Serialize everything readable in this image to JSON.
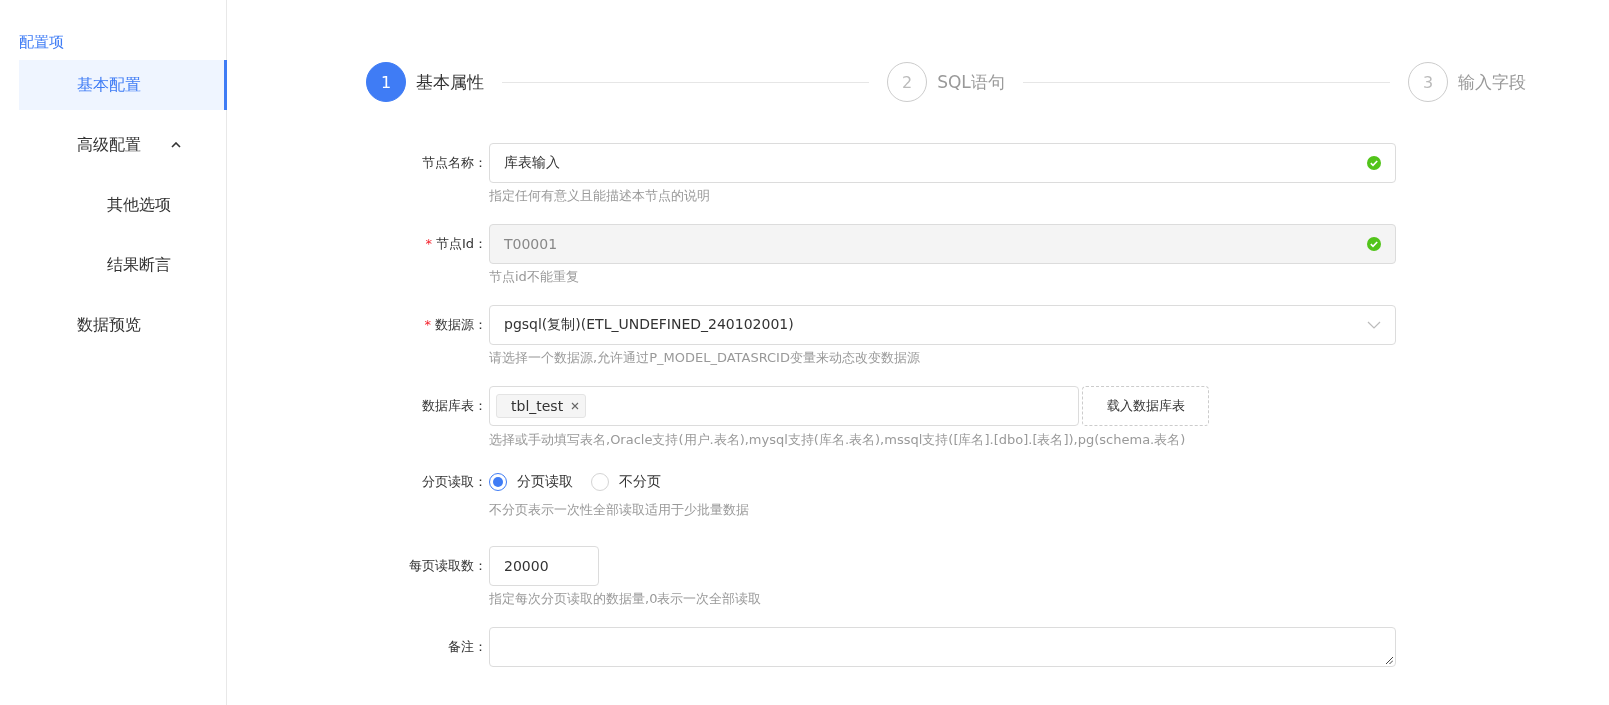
{
  "sidebar": {
    "title": "配置项",
    "items": [
      {
        "label": "基本配置",
        "selected": true
      },
      {
        "label": "高级配置",
        "selected": false,
        "expanded": true,
        "children": [
          {
            "label": "其他选项",
            "selected": false
          },
          {
            "label": "结果断言",
            "selected": false
          }
        ]
      },
      {
        "label": "数据预览",
        "selected": false
      }
    ]
  },
  "steps": [
    {
      "number": "1",
      "label": "基本属性",
      "selected": true
    },
    {
      "number": "2",
      "label": "SQL语句",
      "selected": false
    },
    {
      "number": "3",
      "label": "输入字段",
      "selected": false
    }
  ],
  "form": [
    {
      "kind": "text",
      "label": "节点名称：",
      "value": "库表输入",
      "disabled": false,
      "valid": true,
      "help": "指定任何有意义且能描述本节点的说明"
    },
    {
      "kind": "text",
      "label": "节点Id：",
      "mark": "*",
      "value": "T00001",
      "disabled": true,
      "valid": true,
      "help": "节点id不能重复"
    },
    {
      "kind": "select",
      "label": "数据源：",
      "mark": "*",
      "value": "pgsql(复制)(ETL_UNDEFINED_240102001)",
      "help": "请选择一个数据源,允许通过P_MODEL_DATASRCID变量来动态改变数据源"
    },
    {
      "kind": "tags",
      "label": "数据库表：",
      "tags": [
        "tbl_test"
      ],
      "button": "载入数据库表",
      "help": "选择或手动填写表名,Oracle支持(用户.表名),mysql支持(库名.表名),mssql支持([库名].[dbo].[表名]),pg(schema.表名)"
    },
    {
      "kind": "radio",
      "label": "分页读取：",
      "options": [
        {
          "label": "分页读取",
          "selected": true
        },
        {
          "label": "不分页",
          "selected": false
        }
      ],
      "help": "不分页表示一次性全部读取适用于少批量数据"
    },
    {
      "kind": "number",
      "label": "每页读取数：",
      "value": "20000",
      "help": "指定每次分页读取的数据量,0表示一次全部读取"
    },
    {
      "kind": "textarea",
      "label": "备注："
    }
  ]
}
